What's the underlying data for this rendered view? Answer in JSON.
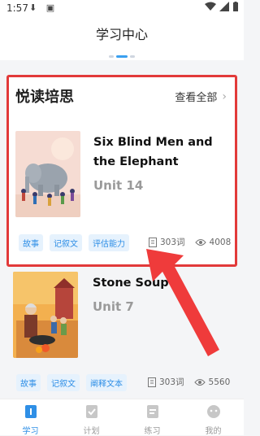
{
  "status": {
    "time": "1:57"
  },
  "header": {
    "title": "学习中心",
    "tabs": [
      "",
      "",
      " ",
      "",
      " "
    ]
  },
  "section": {
    "title": "悦读培思",
    "view_all": "查看全部"
  },
  "books": [
    {
      "title": "Six Blind Men and the Elephant",
      "unit": "Unit 14",
      "tags": [
        "故事",
        "记叙文",
        "评估能力"
      ],
      "words": "303词",
      "views": "4008"
    },
    {
      "title": "Stone Soup",
      "unit": "Unit 7",
      "tags": [
        "故事",
        "记叙文",
        "阐释文本"
      ],
      "words": "303词",
      "views": "5560"
    }
  ],
  "tabbar": [
    {
      "label": "学习",
      "icon": "study-icon",
      "active": true
    },
    {
      "label": "计划",
      "icon": "plan-icon",
      "active": false
    },
    {
      "label": "练习",
      "icon": "practice-icon",
      "active": false
    },
    {
      "label": "我的",
      "icon": "profile-icon",
      "active": false
    }
  ],
  "colors": {
    "accent": "#2f8fe6",
    "highlight": "#e23a3a"
  }
}
